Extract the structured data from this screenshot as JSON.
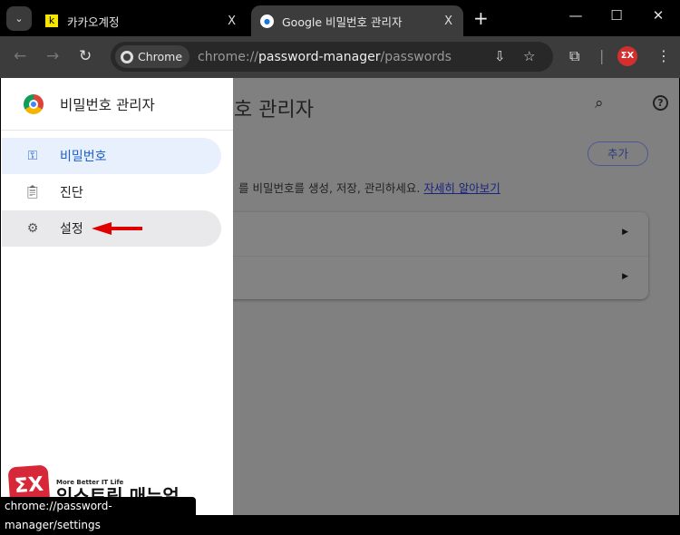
{
  "tabs": [
    {
      "label": "카카오계정",
      "favicon": "k",
      "close": "X"
    },
    {
      "label": "Google 비밀번호 관리자",
      "close": "X",
      "active": true
    }
  ],
  "new_tab": "+",
  "window": {
    "minimize": "—",
    "maximize": "☐",
    "close": "✕"
  },
  "toolbar": {
    "chip_label": "Chrome",
    "url_prefix": "chrome://",
    "url_host": "password-manager",
    "url_path": "/passwords",
    "profile_badge": "ΣX"
  },
  "sidebar": {
    "title": "비밀번호 관리자",
    "items": [
      {
        "label": "비밀번호",
        "icon": "key-icon"
      },
      {
        "label": "진단",
        "icon": "clipboard-check-icon"
      },
      {
        "label": "설정",
        "icon": "gear-icon"
      }
    ]
  },
  "background": {
    "title_fragment": "호 관리자",
    "add_button": "추가",
    "description": "를 비밀번호를 생성, 저장, 관리하세요.",
    "learn_more": "자세히 알아보기"
  },
  "status_url": "chrome://password-manager/settings",
  "watermark": {
    "tagline": "More Better IT Life",
    "name": "익스트림 매뉴얼",
    "logo": "ΣX"
  },
  "colors": {
    "accent": "#1a5fcc",
    "arrow": "#e00000",
    "overlay": "#808080"
  }
}
